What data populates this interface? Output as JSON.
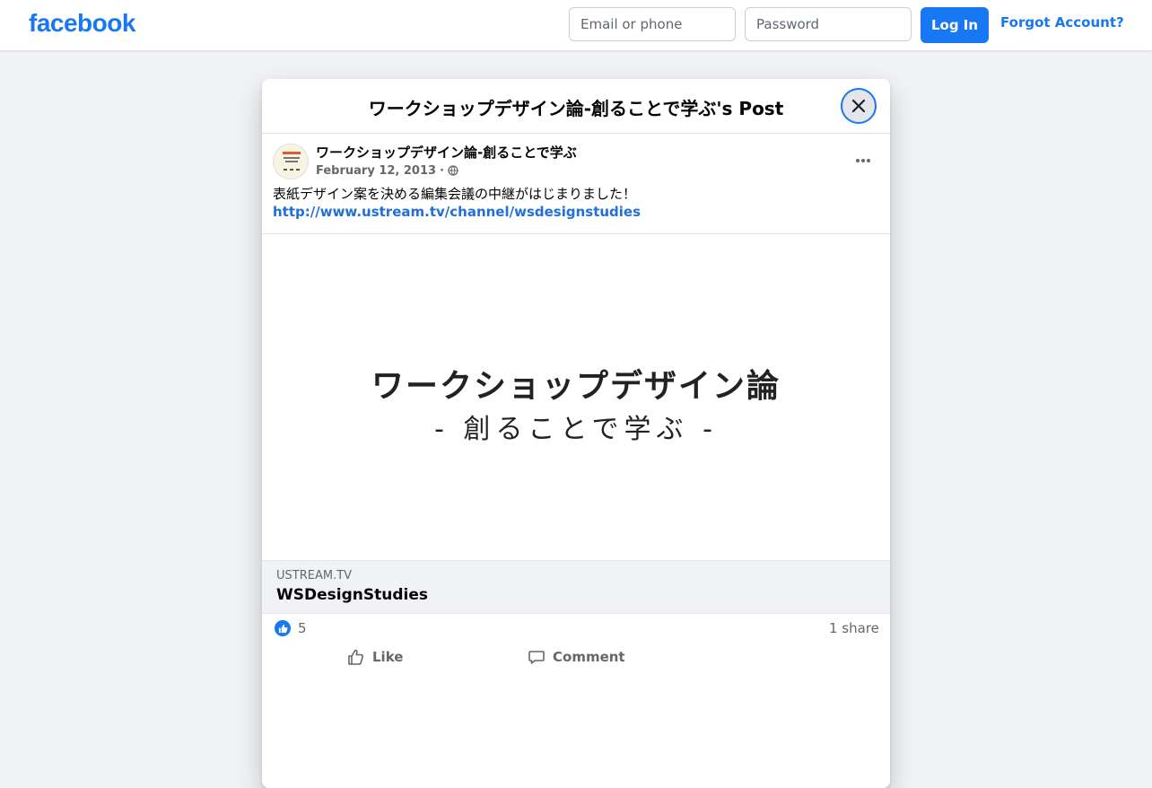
{
  "topbar": {
    "logo": "facebook",
    "email_placeholder": "Email or phone",
    "password_placeholder": "Password",
    "login_label": "Log In",
    "forgot_label": "Forgot Account?"
  },
  "modal": {
    "title": "ワークショップデザイン論-創ることで学ぶ's Post",
    "close_icon": "close-icon"
  },
  "post": {
    "author": "ワークショップデザイン論-創ることで学ぶ",
    "date": "February 12, 2013",
    "separator": "·",
    "privacy_icon": "globe-icon",
    "text": "表紙デザイン案を決める編集会議の中継がはじまりました！",
    "link": "http://www.ustream.tv/channel/wsdesignstudies"
  },
  "preview": {
    "image_line1": "ワークショップデザイン論",
    "image_line2": "- 創ることで学ぶ -",
    "domain": "USTREAM.TV",
    "title": "WSDesignStudies"
  },
  "engagement": {
    "like_count": "5",
    "shares": "1 share",
    "like_label": "Like",
    "comment_label": "Comment"
  },
  "colors": {
    "brand": "#1877f2",
    "background": "#f0f2f5",
    "link": "#216fdb"
  }
}
